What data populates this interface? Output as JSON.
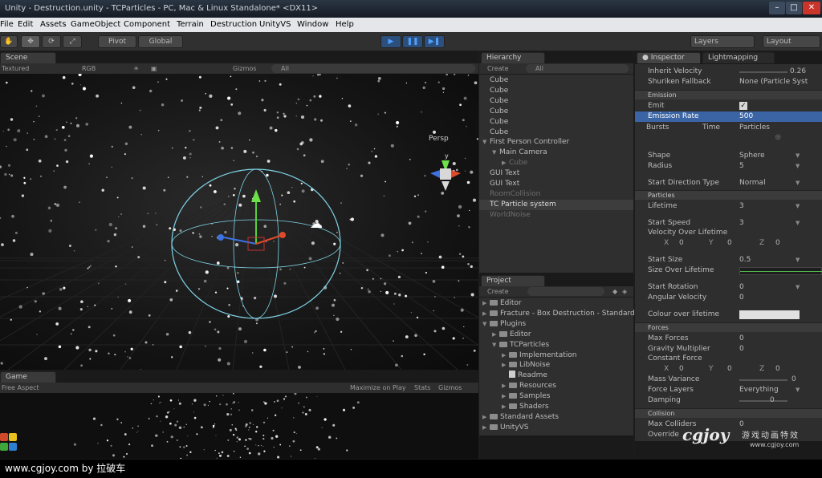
{
  "window": {
    "title": "Unity - Destruction.unity - TCParticles - PC, Mac & Linux Standalone* <DX11>",
    "controls": {
      "minimize": "–",
      "maximize": "□",
      "close": "✕"
    }
  },
  "menu": [
    "File",
    "Edit",
    "Assets",
    "GameObject",
    "Component",
    "Terrain",
    "Destruction",
    "UnityVS",
    "Window",
    "Help"
  ],
  "toolbar": {
    "pivot": "Pivot",
    "global": "Global",
    "layers": "Layers",
    "layout": "Layout",
    "play_icon": "play-icon",
    "pause_icon": "pause-icon",
    "step_icon": "step-icon"
  },
  "scene": {
    "tab": "Scene",
    "shading": "Textured",
    "render_mode": "RGB",
    "gizmos": "Gizmos",
    "search": "All",
    "persp": "Persp",
    "gizmo_y": "y"
  },
  "game": {
    "tab": "Game",
    "aspect": "Free Aspect",
    "maximize": "Maximize on Play",
    "stats": "Stats",
    "gizmos": "Gizmos"
  },
  "hierarchy": {
    "tab": "Hierarchy",
    "create": "Create",
    "search": "All",
    "items": [
      {
        "label": "Cube",
        "indent": 0,
        "state": "normal"
      },
      {
        "label": "Cube",
        "indent": 0,
        "state": "normal"
      },
      {
        "label": "Cube",
        "indent": 0,
        "state": "normal"
      },
      {
        "label": "Cube",
        "indent": 0,
        "state": "normal"
      },
      {
        "label": "Cube",
        "indent": 0,
        "state": "normal"
      },
      {
        "label": "Cube",
        "indent": 0,
        "state": "normal"
      },
      {
        "label": "First Person Controller",
        "indent": 0,
        "state": "expanded"
      },
      {
        "label": "Main Camera",
        "indent": 1,
        "state": "expanded"
      },
      {
        "label": "Cube",
        "indent": 2,
        "state": "dim"
      },
      {
        "label": "GUI Text",
        "indent": 0,
        "state": "normal"
      },
      {
        "label": "GUI Text",
        "indent": 0,
        "state": "normal"
      },
      {
        "label": "RoomCollision",
        "indent": 0,
        "state": "dim"
      },
      {
        "label": "TC Particle system",
        "indent": 0,
        "state": "selected"
      },
      {
        "label": "WorldNoise",
        "indent": 0,
        "state": "dim"
      }
    ]
  },
  "project": {
    "tab": "Project",
    "create": "Create",
    "items": [
      {
        "label": "Editor",
        "indent": 0,
        "type": "folder",
        "arrow": "▶"
      },
      {
        "label": "Fracture - Box Destruction - Standard",
        "indent": 0,
        "type": "folder",
        "arrow": "▶"
      },
      {
        "label": "Plugins",
        "indent": 0,
        "type": "folder",
        "arrow": "▼"
      },
      {
        "label": "Editor",
        "indent": 1,
        "type": "folder",
        "arrow": "▶"
      },
      {
        "label": "TCParticles",
        "indent": 1,
        "type": "folder",
        "arrow": "▼"
      },
      {
        "label": "Implementation",
        "indent": 2,
        "type": "folder",
        "arrow": "▶"
      },
      {
        "label": "LibNoise",
        "indent": 2,
        "type": "folder",
        "arrow": "▶"
      },
      {
        "label": "Readme",
        "indent": 2,
        "type": "file",
        "arrow": ""
      },
      {
        "label": "Resources",
        "indent": 2,
        "type": "folder",
        "arrow": "▶"
      },
      {
        "label": "Samples",
        "indent": 2,
        "type": "folder",
        "arrow": "▶"
      },
      {
        "label": "Shaders",
        "indent": 2,
        "type": "folder",
        "arrow": "▶"
      },
      {
        "label": "Standard Assets",
        "indent": 0,
        "type": "folder",
        "arrow": "▶"
      },
      {
        "label": "UnityVS",
        "indent": 0,
        "type": "folder",
        "arrow": "▶"
      }
    ]
  },
  "inspector": {
    "tab": "Inspector",
    "tab2": "Lightmapping",
    "inherit_velocity": {
      "label": "Inherit Velocity",
      "value": "0.26"
    },
    "shuriken_fallback": {
      "label": "Shuriken Fallback",
      "value": "None (Particle Syst"
    },
    "emission": {
      "header": "Emission",
      "emit": "Emit",
      "emission_rate": {
        "label": "Emission Rate",
        "value": "500"
      },
      "bursts": "Bursts",
      "time": "Time",
      "particles": "Particles",
      "shape": {
        "label": "Shape",
        "value": "Sphere"
      },
      "radius": {
        "label": "Radius",
        "value": "5"
      },
      "start_direction": {
        "label": "Start Direction Type",
        "value": "Normal"
      }
    },
    "particles": {
      "header": "Particles",
      "lifetime": {
        "label": "Lifetime",
        "value": "3"
      },
      "start_speed": {
        "label": "Start Speed",
        "value": "3"
      },
      "velocity_over_lifetime": "Velocity Over Lifetime",
      "vx": {
        "label": "X",
        "value": "0"
      },
      "vy": {
        "label": "Y",
        "value": "0"
      },
      "vz": {
        "label": "Z",
        "value": "0"
      },
      "start_size": {
        "label": "Start Size",
        "value": "0.5"
      },
      "size_over_lifetime": "Size Over Lifetime",
      "start_rotation": {
        "label": "Start Rotation",
        "value": "0"
      },
      "angular_velocity": {
        "label": "Angular Velocity",
        "value": "0"
      },
      "colour_over_lifetime": "Colour over lifetime"
    },
    "forces": {
      "header": "Forces",
      "max_forces": {
        "label": "Max Forces",
        "value": "0"
      },
      "gravity_multiplier": {
        "label": "Gravity Multiplier",
        "value": "0"
      },
      "constant_force": "Constant Force",
      "fx": {
        "label": "X",
        "value": "0"
      },
      "fy": {
        "label": "Y",
        "value": "0"
      },
      "fz": {
        "label": "Z",
        "value": "0"
      },
      "mass_variance": {
        "label": "Mass Variance",
        "value": "0"
      },
      "force_layers": {
        "label": "Force Layers",
        "value": "Everything"
      },
      "damping": {
        "label": "Damping",
        "value": "0"
      }
    },
    "collision": {
      "header": "Collision",
      "max_colliders": {
        "label": "Max Colliders",
        "value": "0"
      },
      "override": {
        "label": "Override",
        "value": ""
      }
    }
  },
  "watermark": {
    "logo": "cgjoy",
    "site": "www.cgjoy.com",
    "cn": "游戏动画特效"
  },
  "status": {
    "text": "www.cgjoy.com by 拉破车"
  }
}
